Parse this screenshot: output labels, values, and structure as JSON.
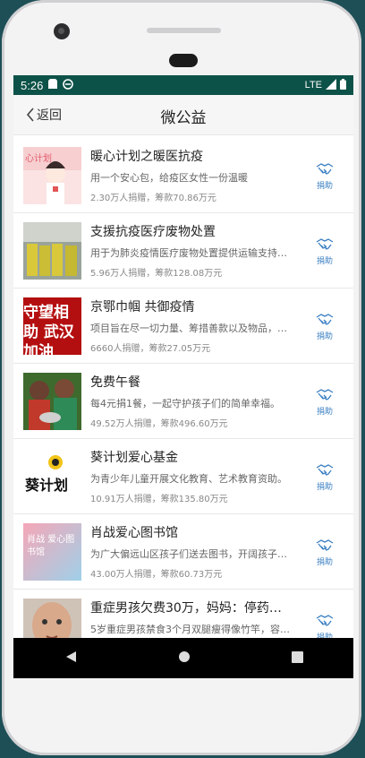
{
  "status": {
    "time": "5:26",
    "network": "LTE"
  },
  "nav": {
    "back_label": "返回",
    "title": "微公益"
  },
  "items": [
    {
      "title": "暖心计划之暖医抗疫",
      "desc": "用一个安心包，给疫区女性一份温暖",
      "stats": "2.30万人捐赠，筹款70.86万元",
      "donate": "捐助",
      "thumb_text": "心计划"
    },
    {
      "title": "支援抗疫医疗废物处置",
      "desc": "用于为肺炎疫情医疗废物处置提供运输支持…",
      "stats": "5.96万人捐赠，筹款128.08万元",
      "donate": "捐助"
    },
    {
      "title": "京鄂巾帼 共御疫情",
      "desc": "项目旨在尽一切力量、筹措善款以及物品，…",
      "stats": "6660人捐赠，筹款27.05万元",
      "donate": "捐助",
      "thumb_text": "守望相助 武汉加油"
    },
    {
      "title": "免费午餐",
      "desc": "每4元捐1餐，一起守护孩子们的简单幸福。",
      "stats": "49.52万人捐赠，筹款496.60万元",
      "donate": "捐助"
    },
    {
      "title": "葵计划爱心基金",
      "desc": "为青少年儿童开展文化教育、艺术教育资助。",
      "stats": "10.91万人捐赠，筹款135.80万元",
      "donate": "捐助",
      "thumb_text": "葵计划"
    },
    {
      "title": "肖战爱心图书馆",
      "desc": "为广大偏远山区孩子们送去图书，开阔孩子…",
      "stats": "43.00万人捐赠，筹款60.73万元",
      "donate": "捐助",
      "thumb_text": "肖战 爱心图书馆"
    },
    {
      "title": "重症男孩欠费30万，妈妈：停药…",
      "desc": "5岁重症男孩禁食3个月双腿瘦得像竹竿，容…",
      "stats": "",
      "donate": "捐助"
    }
  ]
}
